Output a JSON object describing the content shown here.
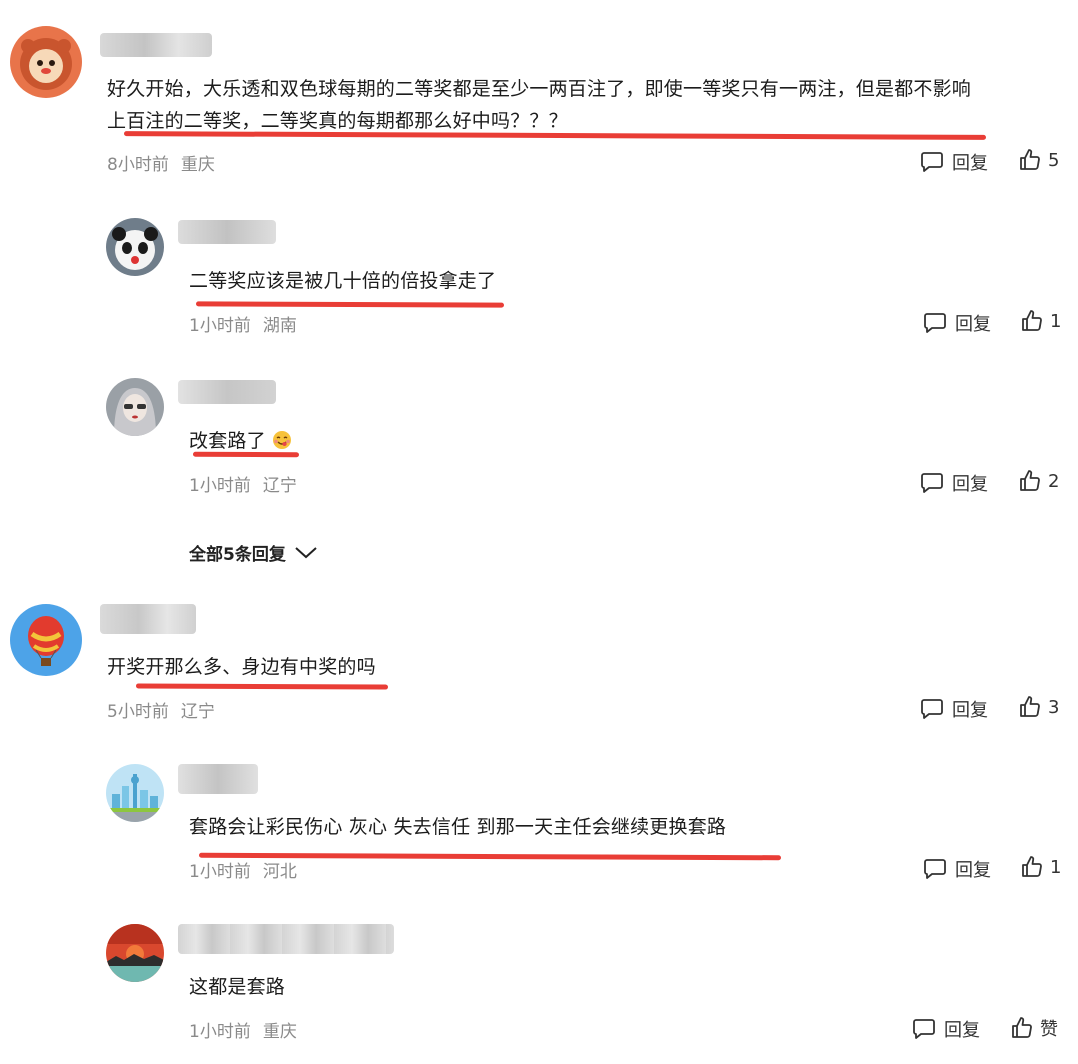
{
  "comments": [
    {
      "text": "好久开始，大乐透和双色球每期的二等奖都是至少一两百注了，即使一等奖只有一两注，但是都不影响",
      "text2": "上百注的二等奖，二等奖真的每期都那么好中吗？？？",
      "time": "8小时前",
      "location": "重庆",
      "reply_label": "回复",
      "likes": "5"
    },
    {
      "text": "二等奖应该是被几十倍的倍投拿走了",
      "time": "1小时前",
      "location": "湖南",
      "reply_label": "回复",
      "likes": "1"
    },
    {
      "text": "改套路了",
      "emoji": "face-savoring-emoji",
      "time": "1小时前",
      "location": "辽宁",
      "reply_label": "回复",
      "likes": "2"
    },
    {
      "text": "开奖开那么多、身边有中奖的吗",
      "time": "5小时前",
      "location": "辽宁",
      "reply_label": "回复",
      "likes": "3"
    },
    {
      "text": "套路会让彩民伤心 灰心 失去信任 到那一天主任会继续更换套路",
      "time": "1小时前",
      "location": "河北",
      "reply_label": "回复",
      "likes": "1"
    },
    {
      "text": "这都是套路",
      "time": "1小时前",
      "location": "重庆",
      "reply_label": "回复",
      "likes": "赞"
    }
  ],
  "expand_replies": {
    "label": "全部5条回复"
  },
  "colors": {
    "underline": "#e8332b",
    "meta": "#8a8a8a",
    "text": "#1c1c1c"
  }
}
